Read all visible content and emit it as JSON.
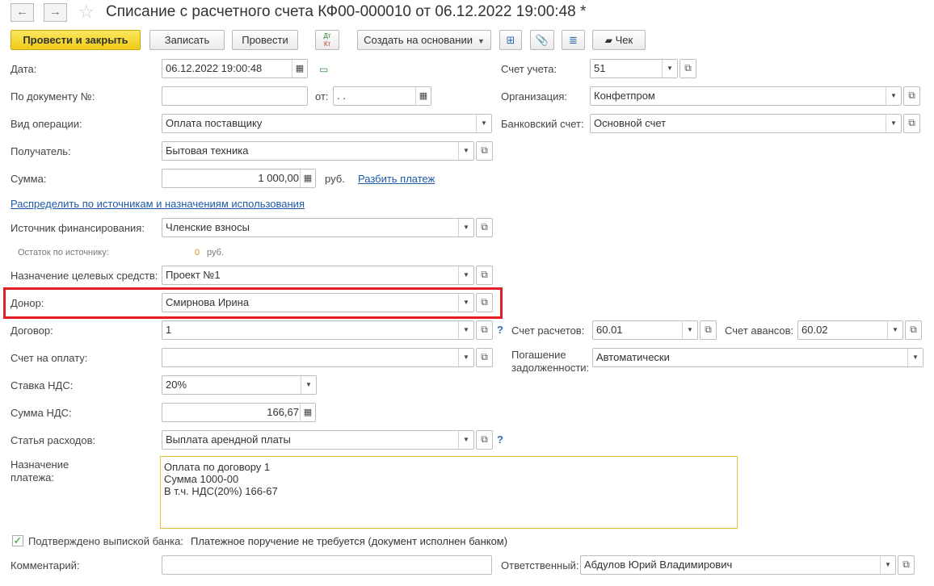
{
  "title": "Списание с расчетного счета КФ00-000010 от 06.12.2022 19:00:48 *",
  "nav": {
    "back": "←",
    "forward": "→",
    "star": "☆"
  },
  "toolbar": {
    "post_close": "Провести и закрыть",
    "save": "Записать",
    "post": "Провести",
    "dtkt_top": "Дт",
    "dtkt_bottom": "Кт",
    "create_based": "Создать на основании",
    "check": "Чек"
  },
  "form": {
    "date_label": "Дата:",
    "date_value": "06.12.2022 19:00:48",
    "doc_num_label": "По документу №:",
    "doc_num_value": "",
    "from_label": "от:",
    "from_value": " .  .",
    "op_type_label": "Вид операции:",
    "op_type_value": "Оплата поставщику",
    "recipient_label": "Получатель:",
    "recipient_value": "Бытовая техника",
    "sum_label": "Сумма:",
    "sum_value": "1 000,00",
    "currency": "руб.",
    "split_link": "Разбить платеж",
    "distribute_link": "Распределить по источникам и назначениям использования",
    "fin_source_label": "Источник финансирования:",
    "fin_source_value": "Членские взносы",
    "remainder_label": "Остаток по источнику:",
    "remainder_value": "0",
    "remainder_currency": "руб.",
    "purpose_label": "Назначение целевых средств:",
    "purpose_value": "Проект №1",
    "donor_label": "Донор:",
    "donor_value": "Смирнова Ирина",
    "contract_label": "Договор:",
    "contract_value": "1",
    "invoice_label": "Счет на оплату:",
    "invoice_value": "",
    "vat_rate_label": "Ставка НДС:",
    "vat_rate_value": "20%",
    "vat_sum_label": "Сумма НДС:",
    "vat_sum_value": "166,67",
    "expense_label": "Статья расходов:",
    "expense_value": "Выплата арендной платы",
    "payment_purpose_label_1": "Назначение",
    "payment_purpose_label_2": "платежа:",
    "payment_purpose_lines": [
      "Оплата по договору 1",
      "Сумма 1000-00",
      "В т.ч. НДС(20%) 166-67"
    ],
    "bank_confirmed_label": "Подтверждено выпиской банка:",
    "bank_confirmed_checked": true,
    "bank_confirmed_note": "Платежное поручение не требуется (документ исполнен банком)",
    "comment_label": "Комментарий:",
    "comment_value": ""
  },
  "right": {
    "account_label": "Счет учета:",
    "account_value": "51",
    "org_label": "Организация:",
    "org_value": "Конфетпром",
    "bank_acc_label": "Банковский счет:",
    "bank_acc_value": "Основной счет",
    "settle_acc_label": "Счет расчетов:",
    "settle_acc_value": "60.01",
    "advance_acc_label": "Счет авансов:",
    "advance_acc_value": "60.02",
    "debt_label_1": "Погашение",
    "debt_label_2": "задолженности:",
    "debt_value": "Автоматически",
    "responsible_label": "Ответственный:",
    "responsible_value": "Абдулов Юрий Владимирович"
  },
  "colors": {
    "primary_button": "#f1cb16",
    "highlight_border": "#e31e24",
    "link": "#1d5aa8",
    "textarea_border": "#e9c03b"
  }
}
